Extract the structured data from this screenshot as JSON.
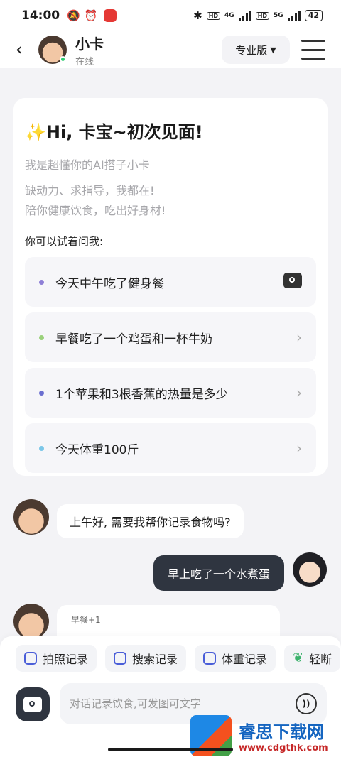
{
  "statusbar": {
    "time": "14:00",
    "net1": "4G",
    "net2": "5G",
    "hd": "HD",
    "battery": "42"
  },
  "header": {
    "name": "小卡",
    "status": "在线",
    "plan_label": "专业版",
    "plan_icon": "caret-down-icon"
  },
  "welcome": {
    "title": "✨Hi, 卡宝~初次见面!",
    "intro": "我是超懂你的AI搭子小卡",
    "line1": "缺动力、求指导，我都在!",
    "line2": "陪你健康饮食，吃出好身材!",
    "try_label": "你可以试着问我:",
    "suggestions": [
      {
        "label": "今天中午吃了健身餐",
        "dot_color": "#8e7fd6",
        "trail": "camera-icon"
      },
      {
        "label": "早餐吃了一个鸡蛋和一杯牛奶",
        "dot_color": "#9ad17b",
        "trail": "chevron-right-icon"
      },
      {
        "label": "1个苹果和3根香蕉的热量是多少",
        "dot_color": "#6b6fd0",
        "trail": "chevron-right-icon"
      },
      {
        "label": "今天体重100斤",
        "dot_color": "#7cc7e8",
        "trail": "chevron-right-icon"
      }
    ]
  },
  "chat": {
    "bot_message": "上午好, 需要我帮你记录食物吗?",
    "user_message": "早上吃了一个水煮蛋",
    "partial_label": "早餐+1"
  },
  "toolbar": {
    "chips": [
      {
        "label": "拍照记录",
        "icon": "scan-icon"
      },
      {
        "label": "搜索记录",
        "icon": "document-search-icon"
      },
      {
        "label": "体重记录",
        "icon": "scale-icon"
      },
      {
        "label": "轻断",
        "icon": "leaf-icon"
      }
    ],
    "input_placeholder": "对话记录饮食,可发图可文字"
  },
  "watermark": {
    "name": "睿思下载网",
    "url": "www.cdgthk.com"
  },
  "colors": {
    "accent_dark": "#2f3540",
    "page_bg": "#f3f3f6",
    "online": "#2ecc71"
  }
}
